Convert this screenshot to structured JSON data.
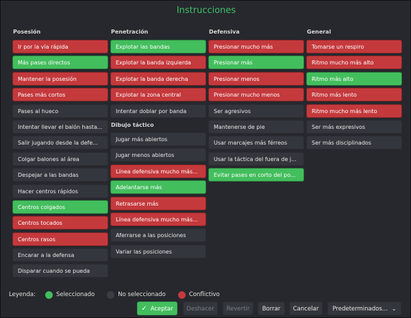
{
  "title": "Instrucciones",
  "columns": [
    {
      "header": "Posesión",
      "items": [
        {
          "label": "Ir por la vía rápida",
          "state": "con"
        },
        {
          "label": "Más pases directos",
          "state": "sel"
        },
        {
          "label": "Mantener la posesión",
          "state": "con"
        },
        {
          "label": "Pases más cortos",
          "state": "con"
        },
        {
          "label": "Pases al hueco",
          "state": "uns"
        },
        {
          "label": "Intentar llevar el balón hasta...",
          "state": "uns"
        },
        {
          "label": "Salir jugando desde la defe...",
          "state": "uns"
        },
        {
          "label": "Colgar balones al área",
          "state": "uns"
        },
        {
          "label": "Despejar a las bandas",
          "state": "uns"
        },
        {
          "label": "Hacer centros rápidos",
          "state": "uns"
        },
        {
          "label": "Centros colgados",
          "state": "sel"
        },
        {
          "label": "Centros tocados",
          "state": "con"
        },
        {
          "label": "Centros rasos",
          "state": "con"
        },
        {
          "label": "Encarar a la defensa",
          "state": "uns"
        },
        {
          "label": "Disparar cuando se pueda",
          "state": "uns"
        }
      ]
    },
    {
      "header": "Penetración",
      "items": [
        {
          "label": "Explotar las bandas",
          "state": "sel"
        },
        {
          "label": "Explotar la banda izquierda",
          "state": "con"
        },
        {
          "label": "Explotar la banda derecha",
          "state": "con"
        },
        {
          "label": "Explotar la zona central",
          "state": "con"
        },
        {
          "label": "Intentar doblar por banda",
          "state": "uns"
        }
      ],
      "subheader": "Dibujo táctico",
      "subitems": [
        {
          "label": "Jugar más abiertos",
          "state": "uns"
        },
        {
          "label": "Jugar menos abiertos",
          "state": "uns"
        },
        {
          "label": "Línea defensiva mucho más...",
          "state": "con"
        },
        {
          "label": "Adelantarse más",
          "state": "sel"
        },
        {
          "label": "Retrasarse más",
          "state": "con"
        },
        {
          "label": "Línea defensiva mucho más...",
          "state": "con"
        },
        {
          "label": "Aferrarse a las posiciones",
          "state": "uns"
        },
        {
          "label": "Variar las posiciones",
          "state": "uns"
        }
      ]
    },
    {
      "header": "Defensiva",
      "items": [
        {
          "label": "Presionar mucho más",
          "state": "con"
        },
        {
          "label": "Presionar más",
          "state": "sel"
        },
        {
          "label": "Presionar menos",
          "state": "con"
        },
        {
          "label": "Presionar mucho menos",
          "state": "con"
        },
        {
          "label": "Ser agresivos",
          "state": "uns"
        },
        {
          "label": "Mantenerse de pie",
          "state": "uns"
        },
        {
          "label": "Usar marcajes más férreos",
          "state": "uns"
        },
        {
          "label": "Usar la táctica del fuera de j...",
          "state": "uns"
        },
        {
          "label": "Evitar pases en corto del po...",
          "state": "sel"
        }
      ]
    },
    {
      "header": "General",
      "items": [
        {
          "label": "Tomarse un respiro",
          "state": "con"
        },
        {
          "label": "Ritmo mucho más alto",
          "state": "con"
        },
        {
          "label": "Ritmo más alto",
          "state": "sel"
        },
        {
          "label": "Ritmo más lento",
          "state": "con"
        },
        {
          "label": "Ritmo mucho más lento",
          "state": "con"
        },
        {
          "label": "Ser más expresivos",
          "state": "uns"
        },
        {
          "label": "Ser más disciplinados",
          "state": "uns"
        }
      ]
    }
  ],
  "legend": {
    "label": "Leyenda:",
    "selected": "Seleccionado",
    "unselected": "No seleccionado",
    "conflict": "Conflictivo"
  },
  "footer": {
    "accept": "Aceptar",
    "undo": "Deshacer",
    "revert": "Revertir",
    "erase": "Borrar",
    "cancel": "Cancelar",
    "defaults": "Predeterminados..."
  },
  "colors": {
    "selected": "#43be5d",
    "conflict": "#c4393c",
    "unselected": "#33363c",
    "title": "#3fbf68"
  }
}
